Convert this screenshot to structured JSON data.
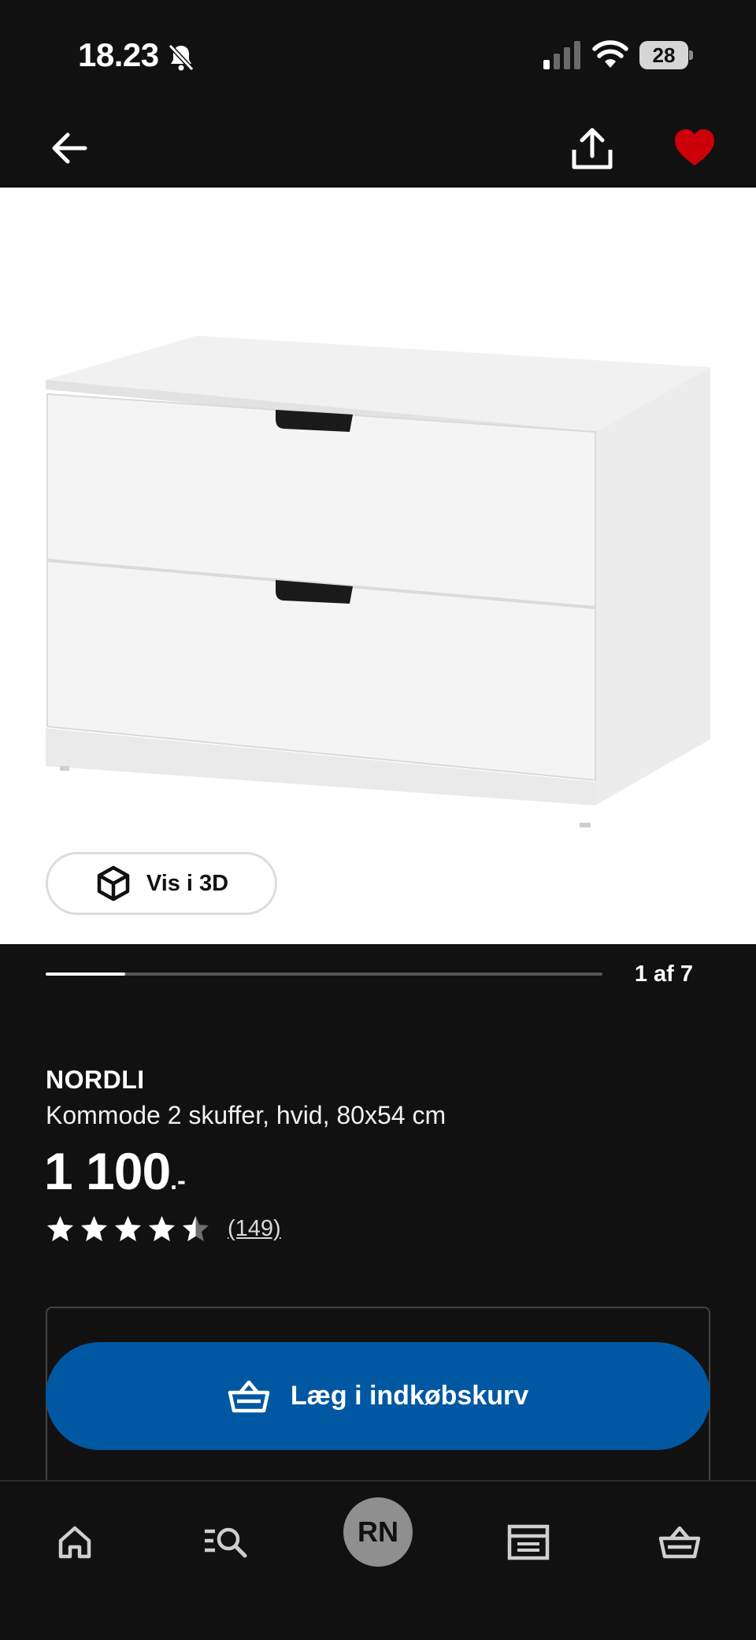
{
  "status_bar": {
    "time": "18.23",
    "battery_level": "28"
  },
  "top_nav": {
    "back_icon": "arrow-left-icon",
    "share_icon": "share-icon",
    "favorite_icon": "heart-icon",
    "favorite_color": "#cc0008"
  },
  "gallery": {
    "view_3d_label": "Vis i 3D",
    "counter": "1 af 7",
    "current_image": 1,
    "total_images": 7
  },
  "product": {
    "name": "NORDLI",
    "description": "Kommode 2 skuffer, hvid, 80x54 cm",
    "price": "1 100",
    "price_suffix": ".-",
    "rating_value": 4.5,
    "rating_max": 5,
    "review_count": "(149)"
  },
  "purchase": {
    "add_to_cart_label": "Læg i indkøbskurv",
    "button_color": "#0058a3"
  },
  "bottom_nav": {
    "items": [
      {
        "name": "home",
        "icon": "home-icon"
      },
      {
        "name": "search",
        "icon": "search-list-icon"
      },
      {
        "name": "profile",
        "label": "RN"
      },
      {
        "name": "stores",
        "icon": "store-icon"
      },
      {
        "name": "cart",
        "icon": "basket-icon"
      }
    ]
  }
}
